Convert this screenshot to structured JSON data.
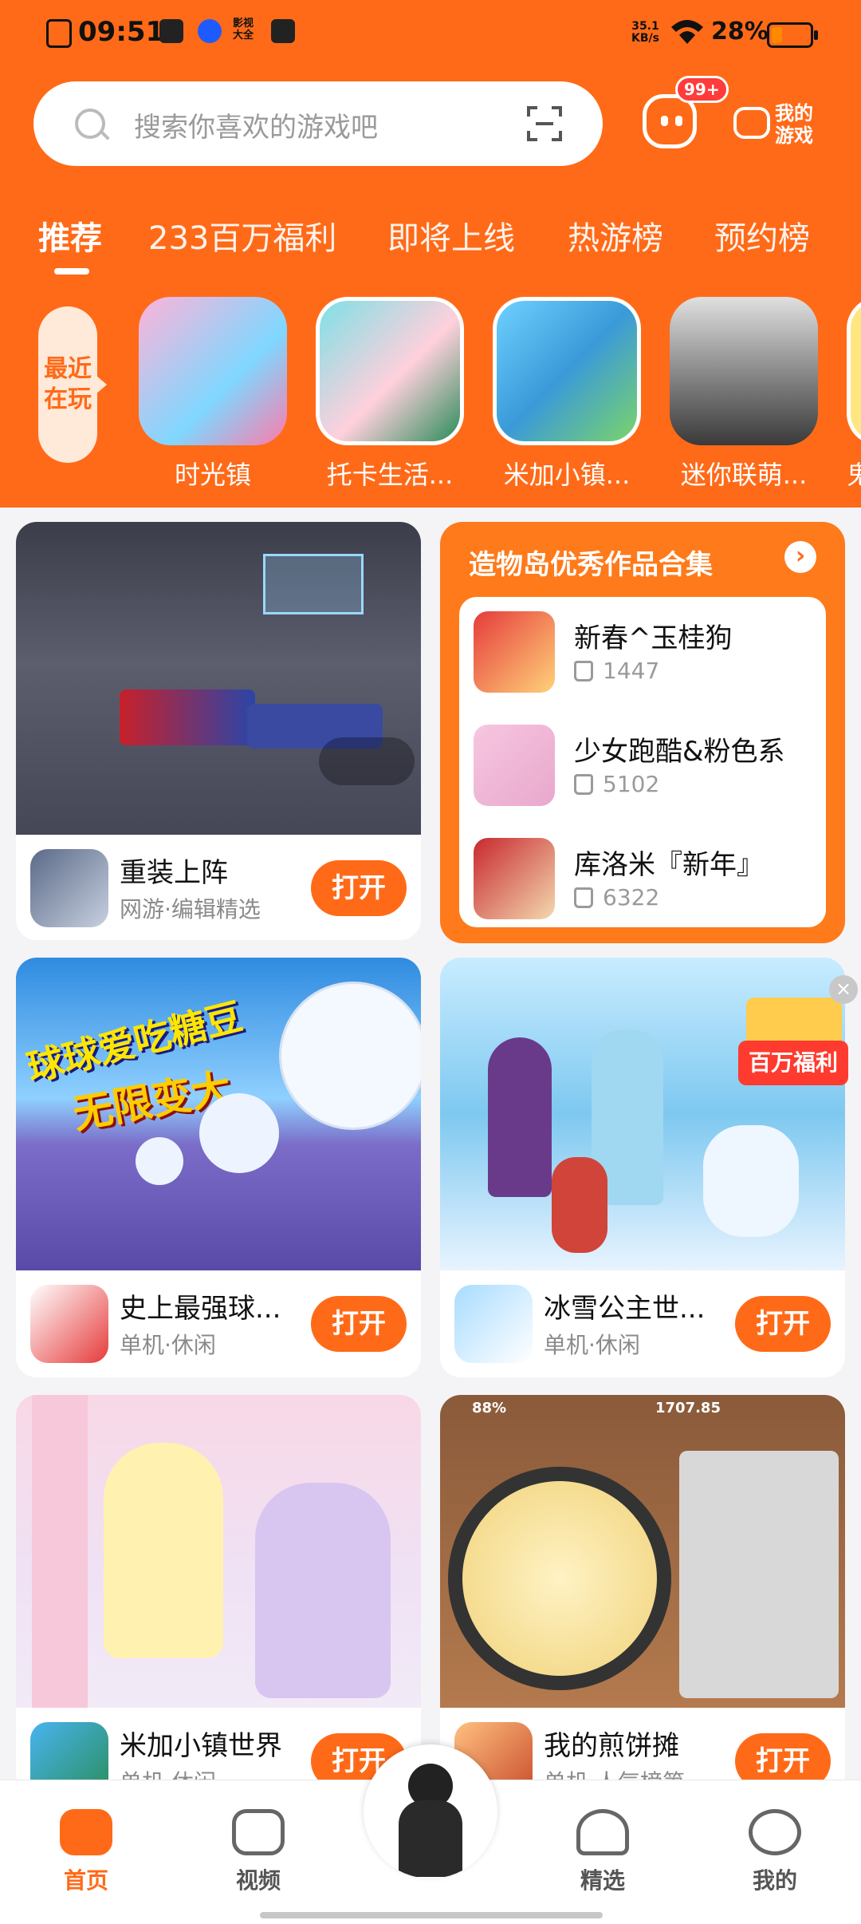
{
  "status": {
    "time": "09:51",
    "net_speed": "35.1",
    "net_unit": "KB/s",
    "battery": "28%",
    "battery_level": 0.28,
    "app_badge": "影视大全"
  },
  "search": {
    "placeholder": "搜索你喜欢的游戏吧",
    "message_badge": "99+",
    "my_games": "我的游戏"
  },
  "tabs": [
    "推荐",
    "233百万福利",
    "即将上线",
    "热游榜",
    "预约榜"
  ],
  "recent": {
    "label": "最近在玩",
    "items": [
      "时光镇",
      "托卡生活...",
      "米加小镇...",
      "迷你联萌...",
      "鬼"
    ]
  },
  "cards": [
    {
      "name": "重装上阵",
      "meta": "网游·编辑精选",
      "button": "打开"
    },
    {
      "name": "史上最强球...",
      "meta": "单机·休闲",
      "button": "打开",
      "banner": "球球爱吃糖豆",
      "banner2": "无限变大"
    },
    {
      "name": "冰雪公主世...",
      "meta": "单机·休闲",
      "button": "打开"
    },
    {
      "name": "米加小镇世界",
      "meta": "单机·休闲",
      "button": "打开"
    },
    {
      "name": "我的煎饼摊",
      "meta": "单机·人气榜第",
      "button": "打开",
      "hud_left": "88%",
      "hud_right": "1707.85"
    }
  ],
  "collection": {
    "title": "造物岛优秀作品合集",
    "items": [
      {
        "name": "新春^玉桂狗",
        "likes": "1447"
      },
      {
        "name": "少女跑酷&粉色系",
        "likes": "5102"
      },
      {
        "name": "库洛米『新年』",
        "likes": "6322"
      }
    ]
  },
  "coupon": "百万福利",
  "bottom_nav": [
    "首页",
    "视频",
    "精选",
    "我的"
  ],
  "colors": {
    "brand": "#ff6a18"
  }
}
